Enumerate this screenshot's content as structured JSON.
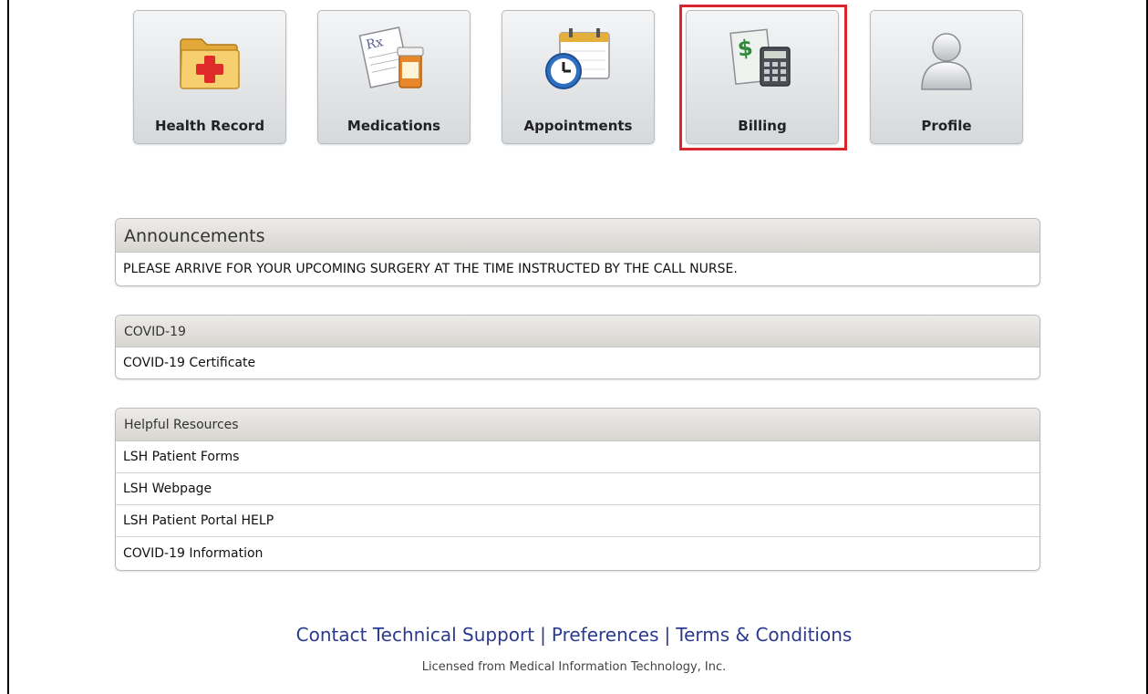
{
  "nav": {
    "health_record": "Health Record",
    "medications": "Medications",
    "appointments": "Appointments",
    "billing": "Billing",
    "profile": "Profile",
    "selected": "Billing"
  },
  "announcements": {
    "title": "Announcements",
    "items": [
      "PLEASE ARRIVE FOR YOUR UPCOMING SURGERY AT THE TIME INSTRUCTED BY THE CALL NURSE."
    ]
  },
  "covid": {
    "title": "COVID-19",
    "items": [
      "COVID-19 Certificate"
    ]
  },
  "resources": {
    "title": "Helpful Resources",
    "items": [
      "LSH Patient Forms",
      "LSH Webpage",
      "LSH Patient Portal HELP",
      "COVID-19 Information"
    ]
  },
  "footer": {
    "links": [
      "Contact Technical Support",
      "Preferences",
      "Terms & Conditions"
    ],
    "separator": "|",
    "license": "Licensed from Medical Information Technology, Inc."
  },
  "colors": {
    "selected_outline": "#d9262c",
    "footer_link": "#2b3a8e",
    "panel_header": "#d8d6d1"
  }
}
